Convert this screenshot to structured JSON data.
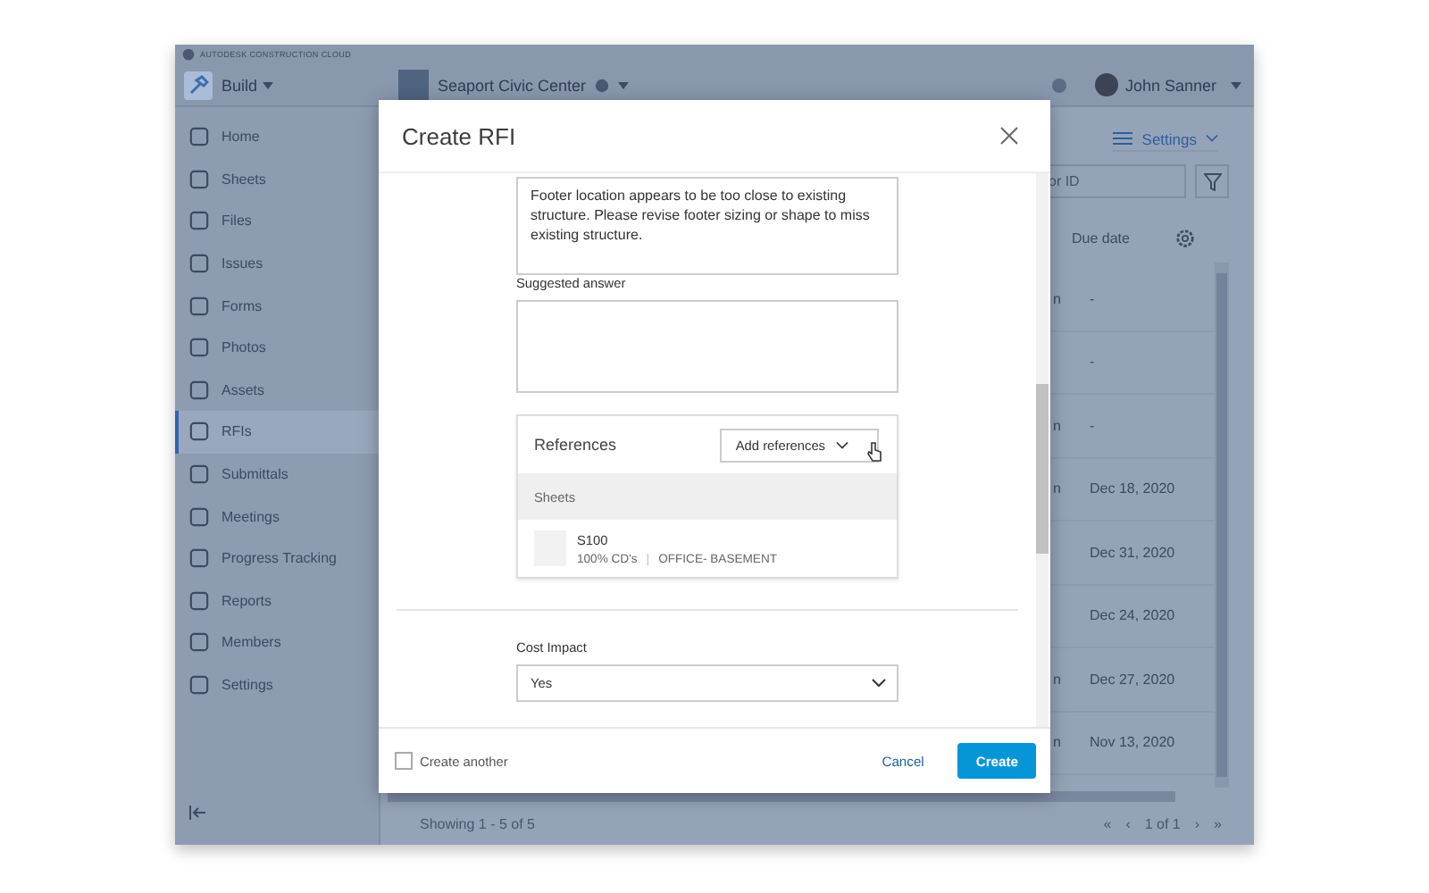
{
  "brand": "AUTODESK CONSTRUCTION CLOUD",
  "header": {
    "module": "Build",
    "project": "Seaport Civic Center",
    "user": "John Sanner"
  },
  "sidebar": {
    "items": [
      {
        "label": "Home",
        "selected": false
      },
      {
        "label": "Sheets",
        "selected": false
      },
      {
        "label": "Files",
        "selected": false
      },
      {
        "label": "Issues",
        "selected": false
      },
      {
        "label": "Forms",
        "selected": false
      },
      {
        "label": "Photos",
        "selected": false
      },
      {
        "label": "Assets",
        "selected": false
      },
      {
        "label": "RFIs",
        "selected": true
      },
      {
        "label": "Submittals",
        "selected": false
      },
      {
        "label": "Meetings",
        "selected": false
      },
      {
        "label": "Progress Tracking",
        "selected": false
      },
      {
        "label": "Reports",
        "selected": false
      },
      {
        "label": "Members",
        "selected": false
      },
      {
        "label": "Settings",
        "selected": false
      }
    ]
  },
  "toolbar": {
    "settings": "Settings",
    "search_placeholder": "or ID"
  },
  "table": {
    "columns": [
      "Due date"
    ],
    "rows": [
      {
        "column_1": "n",
        "due_date": "-"
      },
      {
        "column_1": "",
        "due_date": "-"
      },
      {
        "column_1": "n",
        "due_date": "-"
      },
      {
        "column_1": "n",
        "due_date": "Dec 18, 2020"
      },
      {
        "column_1": "",
        "due_date": "Dec 31, 2020"
      },
      {
        "column_1": "",
        "due_date": "Dec 24, 2020"
      },
      {
        "column_1": "n",
        "due_date": "Dec 27, 2020"
      },
      {
        "column_1": "n",
        "due_date": "Nov 13, 2020"
      }
    ]
  },
  "footer": {
    "showing": "Showing 1 - 5 of 5",
    "first": "«",
    "prev": "‹",
    "page": "1 of 1",
    "next": "›",
    "last": "»"
  },
  "dialog": {
    "title": "Create RFI",
    "description": "Footer location appears to be too close to existing structure. Please revise footer sizing or shape to miss existing structure.",
    "suggested_answer_label": "Suggested answer",
    "references": {
      "title": "References",
      "add_button": "Add references",
      "section": "Sheets",
      "items": [
        {
          "name": "S100",
          "set": "100% CD's",
          "separator": "|",
          "location": "OFFICE- BASEMENT"
        }
      ]
    },
    "cost_impact": {
      "label": "Cost Impact",
      "value": "Yes"
    },
    "create_another": {
      "label": "Create another",
      "checked": false
    },
    "buttons": {
      "cancel": "Cancel",
      "create": "Create"
    }
  }
}
